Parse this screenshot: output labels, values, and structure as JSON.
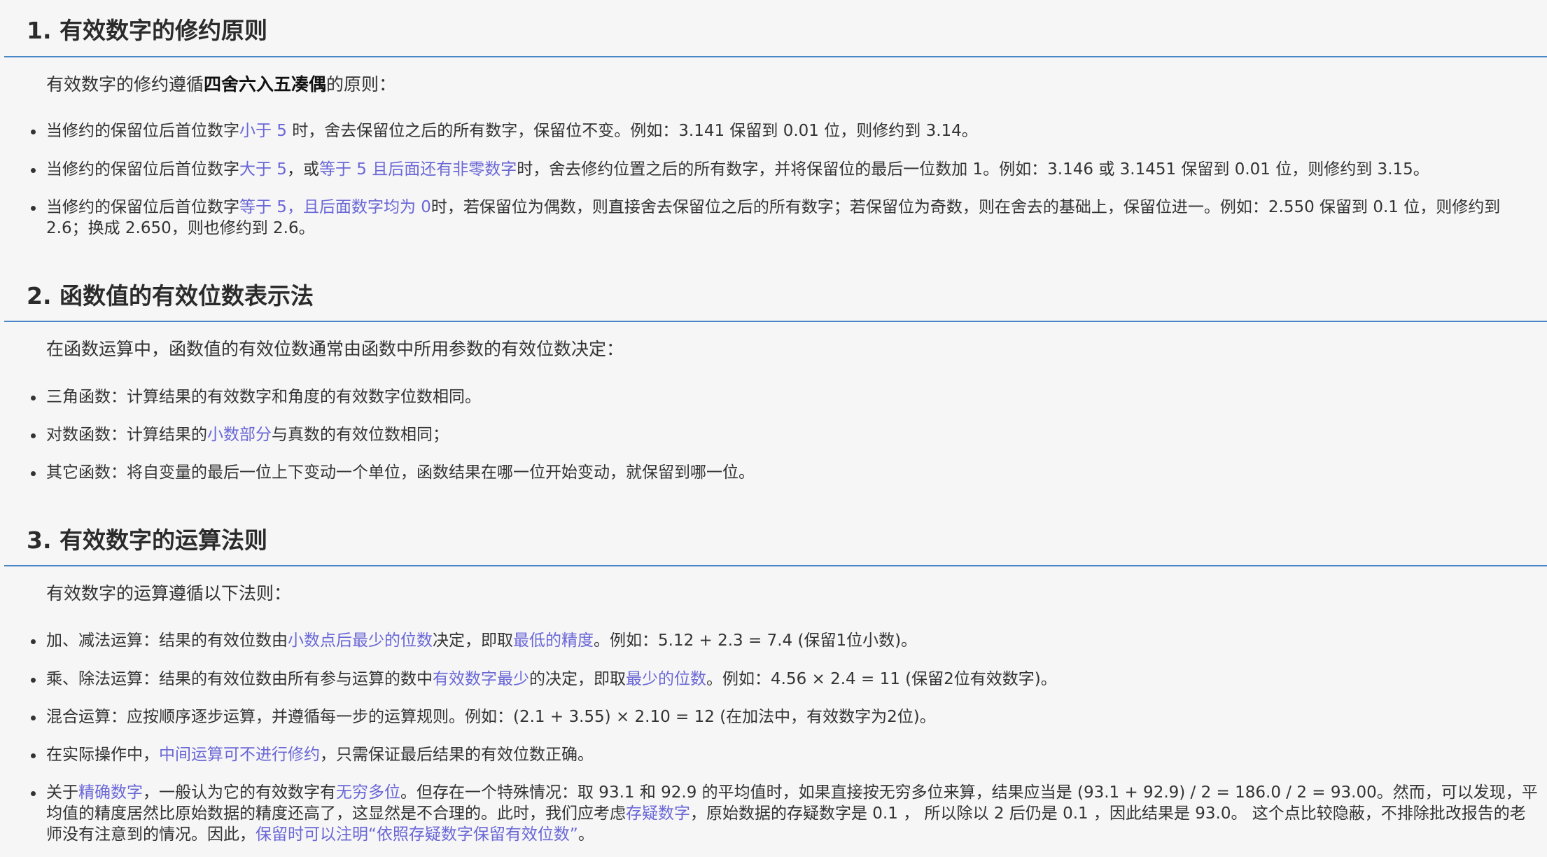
{
  "sections": [
    {
      "title": "1. 有效数字的修约原则",
      "intro": {
        "before": "有效数字的修约遵循",
        "bold": "四舍六入五凑偶",
        "after": "的原则："
      },
      "items": [
        [
          "当修约的保留位后首位数字",
          "小于 5",
          " 时，舍去保留位之后的所有数字，保留位不变。例如：3.141 保留到 0.01 位，则修约到 3.14。"
        ],
        [
          "当修约的保留位后首位数字",
          "大于 5",
          "，或",
          "等于 5 且后面还有非零数字",
          "时，舍去修约位置之后的所有数字，并将保留位的最后一位数加 1。例如：3.146 或 3.1451 保留到 0.01 位，则修约到 3.15。"
        ],
        [
          "当修约的保留位后首位数字",
          "等于 5，且后面数字均为 0",
          "时，若保留位为偶数，则直接舍去保留位之后的所有数字；若保留位为奇数，则在舍去的基础上，保留位进一。例如：2.550 保留到 0.1 位，则修约到 2.6；换成 2.650，则也修约到 2.6。"
        ]
      ]
    },
    {
      "title": "2. 函数值的有效位数表示法",
      "intro": {
        "before": "在函数运算中，函数值的有效位数通常由函数中所用参数的有效位数决定："
      },
      "items": [
        [
          "三角函数：计算结果的有效数字和角度的有效数字位数相同。"
        ],
        [
          "对数函数：计算结果的",
          "小数部分",
          "与真数的有效位数相同；"
        ],
        [
          "其它函数：将自变量的最后一位上下变动一个单位，函数结果在哪一位开始变动，就保留到哪一位。"
        ]
      ]
    },
    {
      "title": "3. 有效数字的运算法则",
      "intro": {
        "before": "有效数字的运算遵循以下法则："
      },
      "items": [
        [
          "加、减法运算：结果的有效位数由",
          "小数点后最少的位数",
          "决定，即取",
          "最低的精度",
          "。例如：5.12 + 2.3 = 7.4 (保留1位小数)。"
        ],
        [
          "乘、除法运算：结果的有效位数由所有参与运算的数中",
          "有效数字最少",
          "的决定，即取",
          "最少的位数",
          "。例如：4.56 × 2.4 = 11 (保留2位有效数字)。"
        ],
        [
          "混合运算：应按顺序逐步运算，并遵循每一步的运算规则。例如：(2.1 + 3.55) × 2.10 = 12 (在加法中，有效数字为2位)。"
        ],
        [
          "在实际操作中，",
          "中间运算可不进行修约",
          "，只需保证最后结果的有效位数正确。"
        ],
        [
          "关于",
          "精确数字",
          "，一般认为它的有效数字有",
          "无穷多位",
          "。但存在一个特殊情况：取 93.1 和 92.9 的平均值时，如果直接按无穷多位来算，结果应当是 (93.1 + 92.9) / 2 = 186.0 / 2 = 93.00。然而，可以发现，平均值的精度居然比原始数据的精度还高了，这显然是不合理的。此时，我们应考虑",
          "存疑数字",
          "，原始数据的存疑数字是 0.1 ， 所以除以 2 后仍是 0.1 ，因此结果是 93.0。 这个点比较隐蔽，不排除批改报告的老师没有注意到的情况。因此，",
          "保留时可以注明“依照存疑数字保留有效位数”",
          "。"
        ]
      ]
    }
  ]
}
